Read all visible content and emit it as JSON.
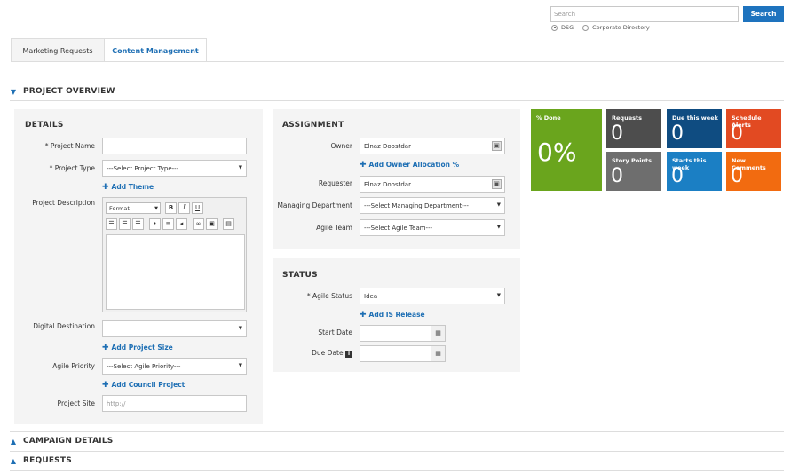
{
  "search": {
    "placeholder": "Search",
    "button_label": "Search",
    "scopes": [
      {
        "label": "DSG",
        "selected": true
      },
      {
        "label": "Corporate Directory",
        "selected": false
      }
    ]
  },
  "tabs": [
    {
      "label": "Marketing Requests",
      "active": true
    },
    {
      "label": "Content Management",
      "active": false
    }
  ],
  "sections": {
    "project_overview": "PROJECT OVERVIEW",
    "campaign_details": "CAMPAIGN DETAILS",
    "requests": "REQUESTS"
  },
  "details": {
    "title": "DETAILS",
    "project_name_label": "* Project Name",
    "project_name_value": "",
    "project_type_label": "* Project Type",
    "project_type_value": "---Select Project Type---",
    "add_theme": "Add Theme",
    "project_description_label": "Project Description",
    "editor": {
      "format_label": "Format",
      "bold": "B",
      "italic": "I",
      "underline": "U"
    },
    "digital_destination_label": "Digital Destination",
    "digital_destination_value": "",
    "add_project_size": "Add Project Size",
    "agile_priority_label": "Agile Priority",
    "agile_priority_value": "---Select Agile Priority---",
    "add_council_project": "Add Council Project",
    "project_site_label": "Project Site",
    "project_site_placeholder": "http://"
  },
  "assignment": {
    "title": "ASSIGNMENT",
    "owner_label": "Owner",
    "owner_value": "Elnaz Doostdar",
    "add_owner_allocation": "Add Owner Allocation %",
    "requester_label": "Requester",
    "requester_value": "Elnaz Doostdar",
    "managing_department_label": "Managing Department",
    "managing_department_value": "---Select Managing Department---",
    "agile_team_label": "Agile Team",
    "agile_team_value": "---Select Agile Team---"
  },
  "status": {
    "title": "STATUS",
    "agile_status_label": "* Agile Status",
    "agile_status_value": "Idea",
    "add_is_release": "Add IS Release",
    "start_date_label": "Start Date",
    "start_date_value": "",
    "due_date_label": "Due Date",
    "due_date_value": ""
  },
  "tiles": [
    {
      "label": "% Done",
      "value": "0%",
      "color": "#6aa51d"
    },
    {
      "label": "Requests",
      "value": "0",
      "color": "#4d4d4d"
    },
    {
      "label": "Due this week",
      "value": "0",
      "color": "#0f4c81"
    },
    {
      "label": "Schedule Alerts",
      "value": "0",
      "color": "#e24a22"
    },
    {
      "label": "Story Points",
      "value": "0",
      "color": "#6e6e6e"
    },
    {
      "label": "Starts this week",
      "value": "0",
      "color": "#1b7fc4"
    },
    {
      "label": "New Comments",
      "value": "0",
      "color": "#f26b10"
    }
  ]
}
